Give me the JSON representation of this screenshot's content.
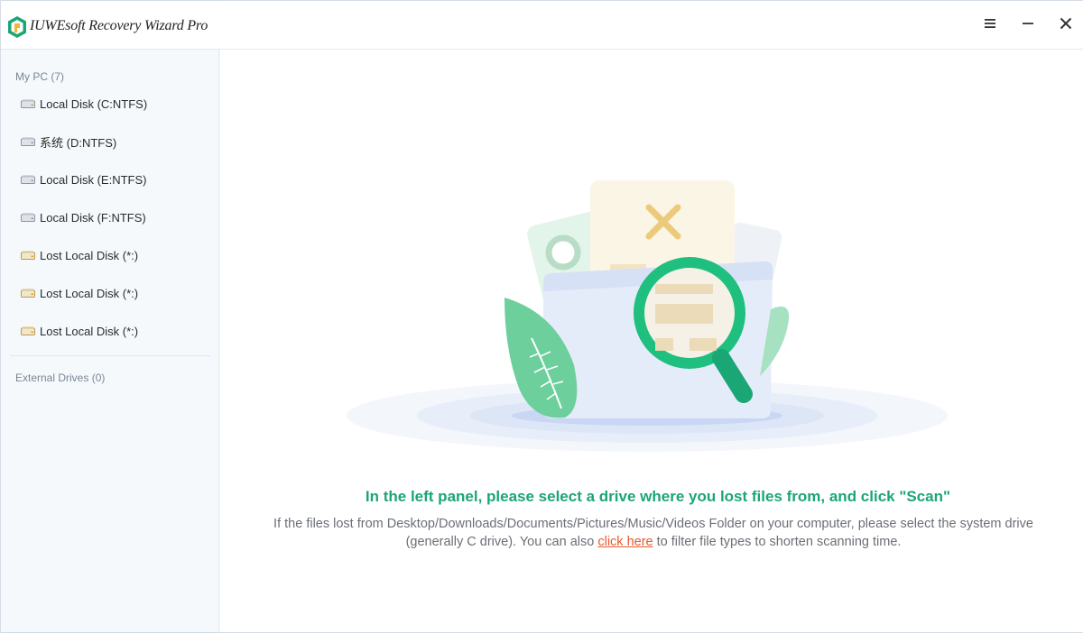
{
  "app": {
    "title": "IUWEsoft Recovery Wizard Pro"
  },
  "window_controls": {
    "menu_icon": "hamburger-menu-icon",
    "minimize_icon": "minimize-icon",
    "close_icon": "close-icon"
  },
  "sidebar": {
    "my_pc_label": "My PC (7)",
    "drives": [
      {
        "label": "Local Disk (C:NTFS)",
        "icon": "hard-drive-icon"
      },
      {
        "label": "系统 (D:NTFS)",
        "icon": "hard-drive-icon"
      },
      {
        "label": "Local Disk (E:NTFS)",
        "icon": "hard-drive-icon"
      },
      {
        "label": "Local Disk (F:NTFS)",
        "icon": "hard-drive-icon"
      },
      {
        "label": "Lost Local Disk (*:)",
        "icon": "lost-drive-icon"
      },
      {
        "label": "Lost Local Disk (*:)",
        "icon": "lost-drive-icon"
      },
      {
        "label": "Lost Local Disk (*:)",
        "icon": "lost-drive-icon"
      }
    ],
    "external_label": "External Drives (0)"
  },
  "main": {
    "headline": "In the left panel, please select a drive where you lost files from, and click \"Scan\"",
    "desc_part1": "If the files lost from Desktop/Downloads/Documents/Pictures/Music/Videos Folder on your computer, please select the system drive (generally C drive). You can also ",
    "desc_link": "click here",
    "desc_part2": " to filter file types to shorten scanning time."
  },
  "colors": {
    "accent_green": "#1ba676",
    "link_orange": "#e8582f",
    "sidebar_bg": "#f5f9fc"
  }
}
